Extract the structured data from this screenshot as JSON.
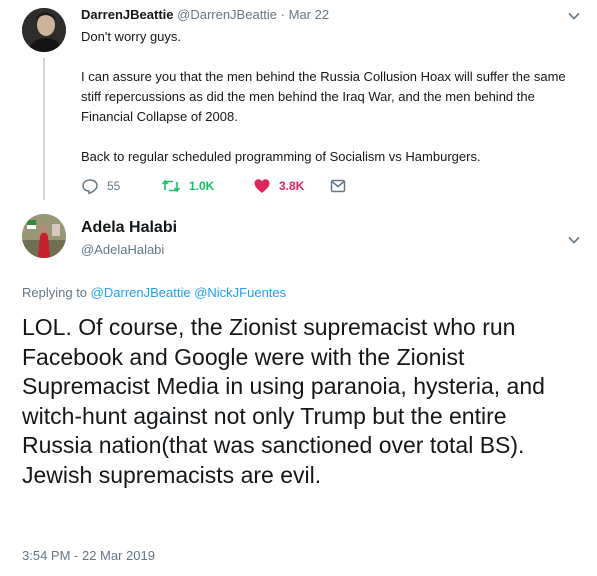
{
  "tweet1": {
    "display_name": "DarrenJBeattie",
    "handle": "@DarrenJBeattie",
    "separator": "·",
    "date": "Mar 22",
    "paragraphs": [
      "Don't worry guys.",
      "I can assure you that the men behind the Russia Collusion Hoax will suffer the same stiff repercussions as did the men behind the Iraq War, and the men behind the Financial Collapse of 2008.",
      "Back to regular scheduled programming of Socialism vs Hamburgers."
    ],
    "actions": {
      "replies": "55",
      "retweets": "1.0K",
      "likes": "3.8K"
    },
    "icons": [
      "reply-icon",
      "retweet-icon",
      "like-icon",
      "direct-message-icon",
      "chevron-down-icon"
    ]
  },
  "tweet2": {
    "display_name": "Adela Halabi",
    "handle": "@AdelaHalabi",
    "replying_prefix": "Replying to",
    "replying_to": [
      "@DarrenJBeattie",
      "@NickJFuentes"
    ],
    "text": "LOL.  Of course, the Zionist supremacist who run Facebook and Google  were with the Zionist Supremacist Media in using paranoia, hysteria, and  witch-hunt against not only Trump but the entire Russia nation(that was sanctioned over total BS). Jewish supremacists are evil.",
    "timestamp": "3:54 PM - 22 Mar 2019",
    "icons": [
      "chevron-down-icon"
    ]
  },
  "colors": {
    "text": "#14171a",
    "secondary": "#657786",
    "link": "#1da1f2",
    "retweet": "#17bf63",
    "like": "#e0245e",
    "thread_line": "#ccd6dd"
  }
}
